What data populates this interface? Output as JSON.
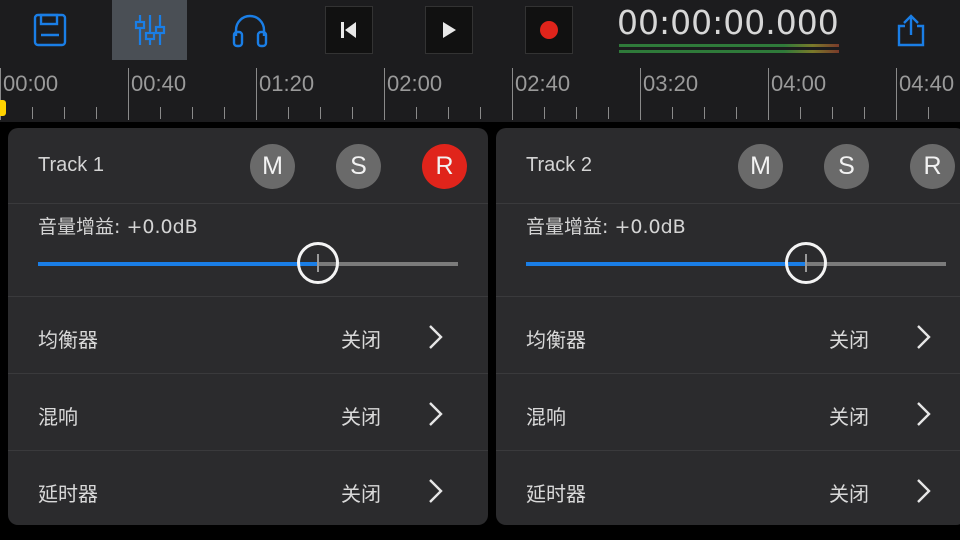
{
  "toolbar": {
    "buttons": [
      {
        "name": "save",
        "icon": "floppy-disk-icon"
      },
      {
        "name": "mixer",
        "icon": "sliders-icon",
        "selected": true
      },
      {
        "name": "monitor",
        "icon": "headphones-icon"
      },
      {
        "name": "rewind",
        "icon": "skip-back-icon"
      },
      {
        "name": "play",
        "icon": "play-icon"
      },
      {
        "name": "record",
        "icon": "record-icon"
      },
      {
        "name": "share",
        "icon": "share-icon"
      }
    ],
    "timecode": "00:00:00.000"
  },
  "timeline": {
    "labels": [
      "00:00",
      "00:40",
      "01:20",
      "02:00",
      "02:40",
      "03:20",
      "04:00",
      "04:40"
    ],
    "playhead_color": "#ffd200"
  },
  "tracks": [
    {
      "name": "Track 1",
      "mute": "M",
      "solo": "S",
      "record": "R",
      "record_armed": true,
      "gain_label": "音量增益:",
      "gain_value": "+0.0dB",
      "gain_fraction": 0.667,
      "effects": [
        {
          "name": "均衡器",
          "state": "关闭"
        },
        {
          "name": "混响",
          "state": "关闭"
        },
        {
          "name": "延时器",
          "state": "关闭"
        }
      ]
    },
    {
      "name": "Track 2",
      "mute": "M",
      "solo": "S",
      "record": "R",
      "record_armed": false,
      "gain_label": "音量增益:",
      "gain_value": "+0.0dB",
      "gain_fraction": 0.667,
      "effects": [
        {
          "name": "均衡器",
          "state": "关闭"
        },
        {
          "name": "混响",
          "state": "关闭"
        },
        {
          "name": "延时器",
          "state": "关闭"
        }
      ]
    }
  ],
  "colors": {
    "accent": "#1a7ee6",
    "record_red": "#e0241b",
    "panel": "#2b2b2d",
    "toolbar": "#1c1c1e"
  }
}
